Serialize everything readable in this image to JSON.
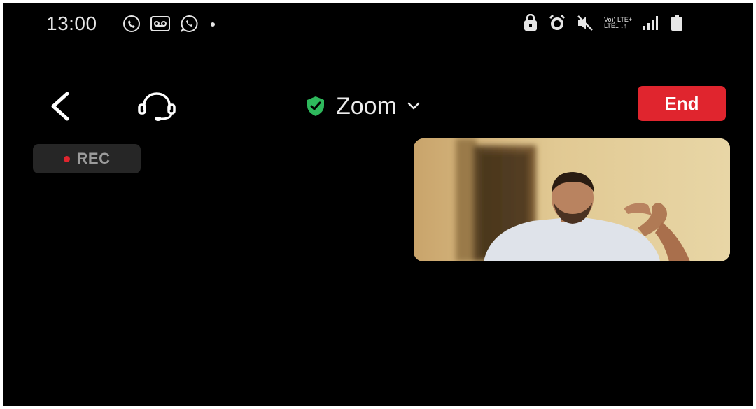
{
  "status_bar": {
    "time": "13:00",
    "left_icons": [
      "call-icon",
      "voicemail-icon",
      "whatsapp-icon",
      "notification-dot-icon"
    ],
    "right_icons": [
      "lock-icon",
      "alarm-icon",
      "mute-icon",
      "volte-lte-icon",
      "signal-icon",
      "battery-icon"
    ],
    "network_line1": "Vo)) LTE+",
    "network_line2": "LTE1 ↓↑"
  },
  "toolbar": {
    "back_icon": "chevron-left-icon",
    "audio_icon": "headset-icon",
    "title": "Zoom",
    "title_icon": "shield-check-icon",
    "dropdown_icon": "chevron-down-icon",
    "end_label": "End"
  },
  "recording": {
    "label": "REC"
  },
  "video_tile": {
    "content": "participant-video"
  },
  "colors": {
    "background": "#000000",
    "end_button": "#e0252e",
    "shield": "#2eb85c",
    "rec_dot": "#e0252e",
    "rec_badge": "#262626"
  }
}
